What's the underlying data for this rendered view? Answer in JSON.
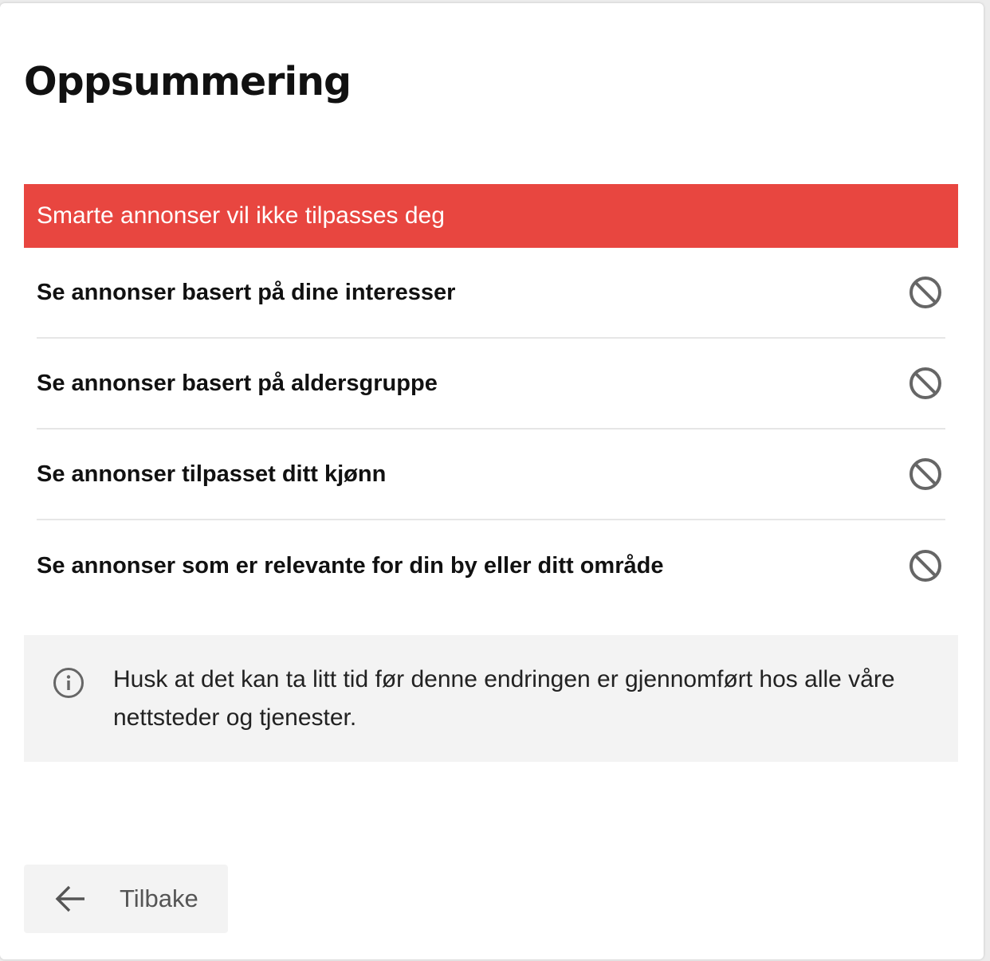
{
  "page": {
    "title": "Oppsummering"
  },
  "banner": {
    "text": "Smarte annonser vil ikke tilpasses deg",
    "color": "#e84640"
  },
  "items": [
    {
      "label": "Se annonser basert på dine interesser",
      "icon": "block-icon"
    },
    {
      "label": "Se annonser basert på aldersgruppe",
      "icon": "block-icon"
    },
    {
      "label": "Se annonser tilpasset ditt kjønn",
      "icon": "block-icon"
    },
    {
      "label": "Se annonser som er relevante for din by eller ditt område",
      "icon": "block-icon"
    }
  ],
  "info": {
    "icon": "info-icon",
    "text": "Husk at det kan ta litt tid før denne endringen er gjennomført hos alle våre nettsteder og tjenester."
  },
  "footer": {
    "back_label": "Tilbake",
    "back_icon": "arrow-left-icon"
  }
}
